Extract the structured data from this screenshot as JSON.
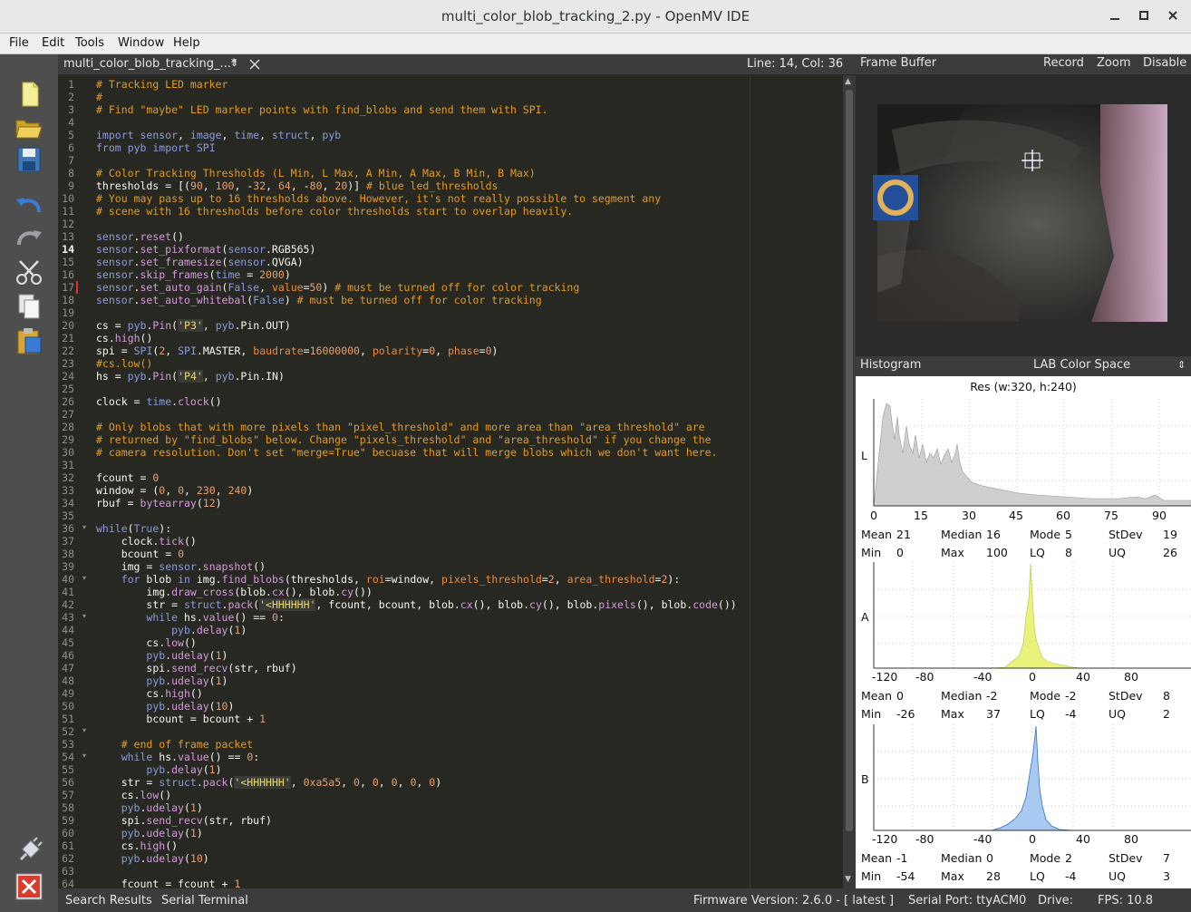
{
  "window": {
    "title": "multi_color_blob_tracking_2.py - OpenMV IDE"
  },
  "menu": [
    "File",
    "Edit",
    "Tools",
    "Window",
    "Help"
  ],
  "toolbar": [
    "new-file-icon",
    "open-file-icon",
    "save-icon",
    "undo-icon",
    "redo-icon",
    "cut-icon",
    "copy-icon",
    "paste-icon",
    "connect-icon",
    "disconnect-icon"
  ],
  "editor": {
    "tab_label": "multi_color_blob_tracking_...*",
    "position": "Line: 14, Col: 36",
    "lines": [
      "# Tracking LED marker",
      "#",
      "# Find \"maybe\" LED marker points with find_blobs and send them with SPI.",
      "",
      "import sensor, image, time, struct, pyb",
      "from pyb import SPI",
      "",
      "# Color Tracking Thresholds (L Min, L Max, A Min, A Max, B Min, B Max)",
      "thresholds = [(90, 100, -32, 64, -80, 20)] # blue led_thresholds",
      "# You may pass up to 16 thresholds above. However, it's not really possible to segment any",
      "# scene with 16 thresholds before color thresholds start to overlap heavily.",
      "",
      "sensor.reset()",
      "sensor.set_pixformat(sensor.RGB565)",
      "sensor.set_framesize(sensor.QVGA)",
      "sensor.skip_frames(time = 2000)",
      "sensor.set_auto_gain(False, value=50) # must be turned off for color tracking",
      "sensor.set_auto_whitebal(False) # must be turned off for color tracking",
      "",
      "cs = pyb.Pin('P3', pyb.Pin.OUT)",
      "cs.high()",
      "spi = SPI(2, SPI.MASTER, baudrate=16000000, polarity=0, phase=0)",
      "#cs.low()",
      "hs = pyb.Pin('P4', pyb.Pin.IN)",
      "",
      "clock = time.clock()",
      "",
      "# Only blobs that with more pixels than \"pixel_threshold\" and more area than \"area_threshold\" are",
      "# returned by \"find_blobs\" below. Change \"pixels_threshold\" and \"area_threshold\" if you change the",
      "# camera resolution. Don't set \"merge=True\" becuase that will merge blobs which we don't want here.",
      "",
      "fcount = 0",
      "window = (0, 0, 230, 240)",
      "rbuf = bytearray(12)",
      "",
      "while(True):",
      "    clock.tick()",
      "    bcount = 0",
      "    img = sensor.snapshot()",
      "    for blob in img.find_blobs(thresholds, roi=window, pixels_threshold=2, area_threshold=2):",
      "        img.draw_cross(blob.cx(), blob.cy())",
      "        str = struct.pack('<HHHHHH', fcount, bcount, blob.cx(), blob.cy(), blob.pixels(), blob.code())",
      "        while hs.value() == 0:",
      "            pyb.delay(1)",
      "        cs.low()",
      "        pyb.udelay(1)",
      "        spi.send_recv(str, rbuf)",
      "        pyb.udelay(1)",
      "        cs.high()",
      "        pyb.udelay(10)",
      "        bcount = bcount + 1",
      "",
      "    # end of frame packet",
      "    while hs.value() == 0:",
      "        pyb.delay(1)",
      "    str = struct.pack('<HHHHHH', 0xa5a5, 0, 0, 0, 0, 0)",
      "    cs.low()",
      "    pyb.udelay(1)",
      "    spi.send_recv(str, rbuf)",
      "    pyb.udelay(1)",
      "    cs.high()",
      "    pyb.udelay(10)",
      "",
      "    fcount = fcount + 1"
    ]
  },
  "frame_buffer": {
    "header": "Frame Buffer",
    "record": "Record",
    "zoom": "Zoom",
    "disable": "Disable"
  },
  "histogram": {
    "header": "Histogram",
    "color_space": "LAB Color Space",
    "res": "Res (w:320, h:240)",
    "channels": [
      {
        "name": "L",
        "ticks": [
          "0",
          "15",
          "30",
          "45",
          "60",
          "75",
          "90"
        ],
        "color": "#c8c8c8",
        "stats": {
          "mean": "21",
          "median": "16",
          "mode": "5",
          "stdev": "19",
          "min": "0",
          "max": "100",
          "lq": "8",
          "uq": "26"
        }
      },
      {
        "name": "A",
        "ticks": [
          "-120",
          "-80",
          "-40",
          "0",
          "40",
          "80"
        ],
        "color": "#e8f070",
        "stats": {
          "mean": "0",
          "median": "-2",
          "mode": "-2",
          "stdev": "8",
          "min": "-26",
          "max": "37",
          "lq": "-4",
          "uq": "2"
        }
      },
      {
        "name": "B",
        "ticks": [
          "-120",
          "-80",
          "-40",
          "0",
          "40",
          "80"
        ],
        "color": "#a9c8f0",
        "stats": {
          "mean": "-1",
          "median": "0",
          "mode": "2",
          "stdev": "7",
          "min": "-54",
          "max": "28",
          "lq": "-4",
          "uq": "3"
        }
      }
    ],
    "stat_labels": {
      "mean": "Mean",
      "median": "Median",
      "mode": "Mode",
      "stdev": "StDev",
      "min": "Min",
      "max": "Max",
      "lq": "LQ",
      "uq": "UQ"
    }
  },
  "status": {
    "search": "Search Results",
    "serial": "Serial Terminal",
    "firmware": "Firmware Version: 2.6.0 - [ latest ]",
    "port": "Serial Port: ttyACM0",
    "drive": "Drive:",
    "fps": "FPS:  10.8"
  }
}
